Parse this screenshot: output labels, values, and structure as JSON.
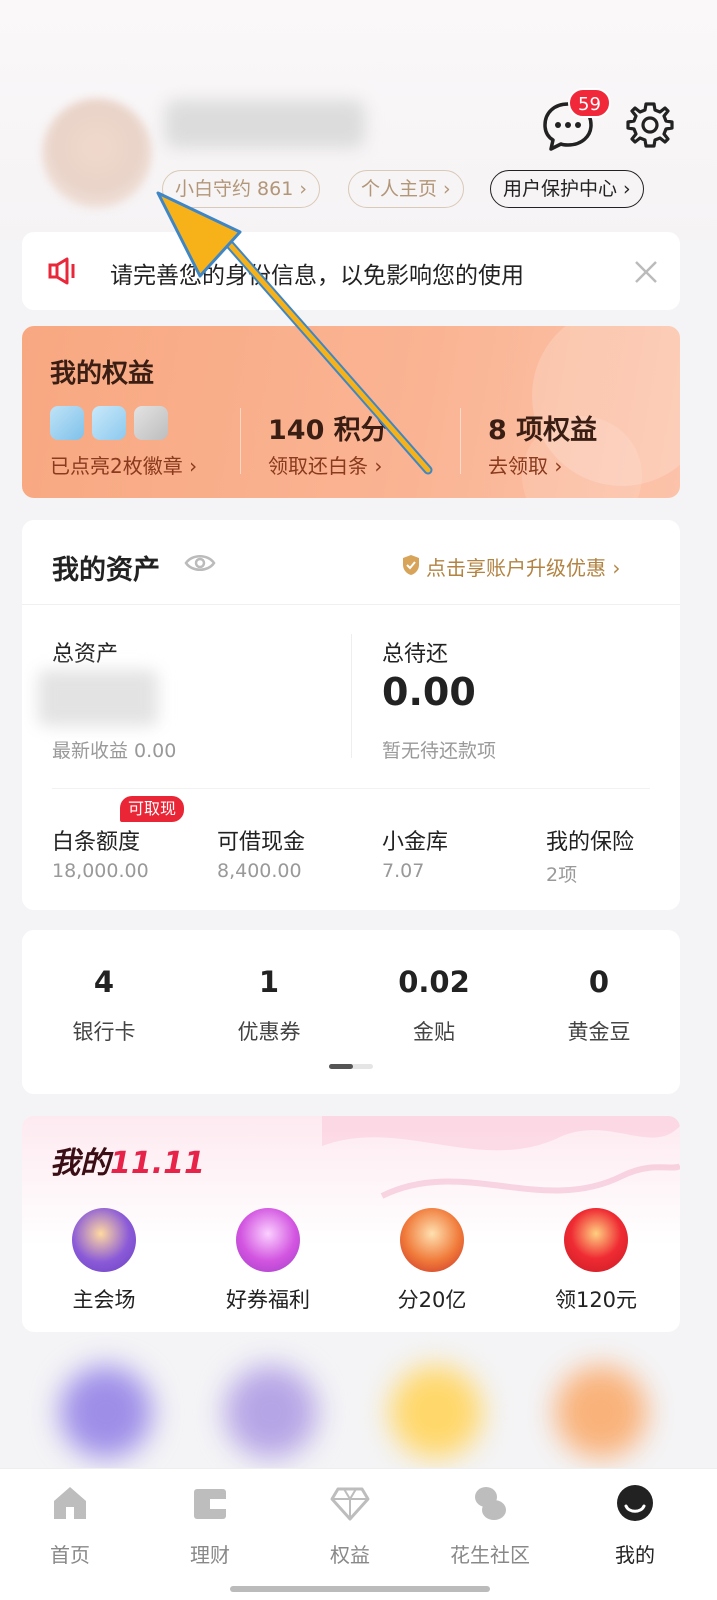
{
  "header": {
    "badge_count": "59",
    "pills": [
      "小白守约 861 ›",
      "个人主页 ›",
      "用户保护中心 ›"
    ]
  },
  "notice": {
    "text": "请完善您的身份信息，以免影响您的使用"
  },
  "rights": {
    "title": "我的权益",
    "col1_link": "已点亮2枚徽章 ›",
    "col2_value": "140 积分",
    "col2_link": "领取还白条 ›",
    "col3_value": "8 项权益",
    "col3_link": "去领取 ›"
  },
  "assets": {
    "title": "我的资产",
    "upgrade": "点击享账户升级优惠 ›",
    "total_label": "总资产",
    "earnings": "最新收益 0.00",
    "pending_label": "总待还",
    "pending_value": "0.00",
    "pending_note": "暂无待还款项",
    "tag": "可取现",
    "items": [
      {
        "label": "白条额度",
        "value": "18,000.00"
      },
      {
        "label": "可借现金",
        "value": "8,400.00"
      },
      {
        "label": "小金库",
        "value": "7.07"
      },
      {
        "label": "我的保险",
        "value": "2项"
      }
    ]
  },
  "stats": [
    {
      "num": "4",
      "label": "银行卡"
    },
    {
      "num": "1",
      "label": "优惠券"
    },
    {
      "num": "0.02",
      "label": "金贴"
    },
    {
      "num": "0",
      "label": "黄金豆"
    }
  ],
  "promo": {
    "title_a": "我的",
    "title_b": "11.11",
    "items": [
      "主会场",
      "好券福利",
      "分20亿",
      "领120元"
    ]
  },
  "tabs": [
    "首页",
    "理财",
    "权益",
    "花生社区",
    "我的"
  ],
  "colors": {
    "accent_red": "#f0283a",
    "rights_bg": "#f8a881",
    "arrow": "#f7b21a"
  }
}
